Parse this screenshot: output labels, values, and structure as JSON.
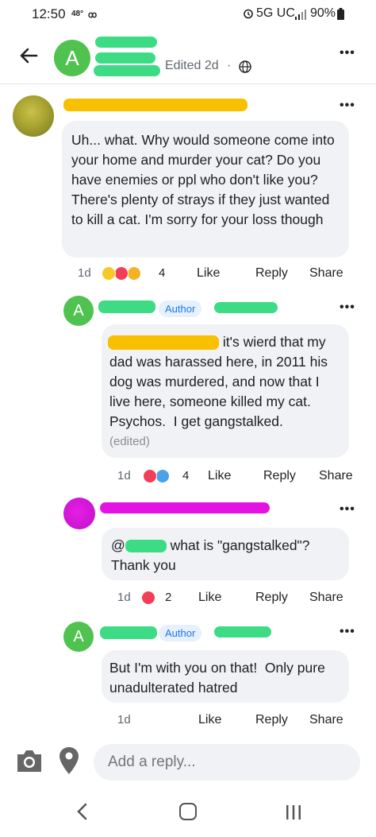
{
  "status_bar": {
    "time": "12:50",
    "temp": "48°",
    "voicemail": "ꝏ",
    "network": "5G UC",
    "battery": "90%"
  },
  "header": {
    "avatar_letter": "A",
    "edited": "Edited 2d",
    "dot": "·",
    "more": "•••"
  },
  "comments": [
    {
      "text": "Uh... what. Why would someone come into your home and murder your cat? Do you have enemies or ppl who don't like you? There's plenty of strays if they just wanted to kill a cat. I'm sorry for your loss though",
      "time": "1d",
      "reaction_count": "4",
      "like": "Like",
      "reply": "Reply",
      "share": "Share",
      "more": "•••"
    },
    {
      "avatar_letter": "A",
      "badge": "Author",
      "text": " it's wierd that my dad was harassed here, in 2011 his dog was murdered, and now that I live here, someone killed my cat.  Psychos.  I get gangstalked.",
      "edited": "(edited)",
      "time": "1d",
      "reaction_count": "4",
      "like": "Like",
      "reply": "Reply",
      "share": "Share",
      "more": "•••"
    },
    {
      "mention_prefix": "@",
      "text": " what is \"gangstalked\"? Thank you",
      "time": "1d",
      "reaction_count": "2",
      "like": "Like",
      "reply": "Reply",
      "share": "Share",
      "more": "•••"
    },
    {
      "avatar_letter": "A",
      "badge": "Author",
      "text": "But I'm with you on that!  Only pure unadulterated hatred",
      "time": "1d",
      "like": "Like",
      "reply": "Reply",
      "share": "Share",
      "more": "•••"
    }
  ],
  "composer": {
    "placeholder": "Add a reply..."
  },
  "icons": {
    "back": "back-arrow-icon",
    "globe": "globe-icon",
    "camera": "camera-icon",
    "location": "location-pin-icon"
  },
  "colors": {
    "author_avatar": "#4fc24f",
    "link_blue": "#1877f2",
    "bubble": "#f0f2f5",
    "redaction_green": "#3ddc84",
    "redaction_yellow": "#f8c000",
    "redaction_magenta": "#e314e3"
  }
}
